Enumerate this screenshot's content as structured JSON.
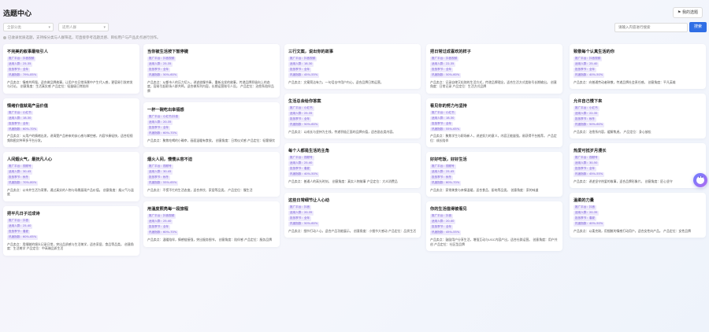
{
  "header": {
    "title": "选题中心",
    "my_button": "我的选题",
    "filters": [
      {
        "placeholder": "全部分类"
      },
      {
        "placeholder": "适用人群"
      }
    ],
    "search_placeholder": "请输入内容进行搜索",
    "search_button": "搜索",
    "tip": "已收录优质选题，支持按分类与人群筛选，可直接参考选题灵感、目标用户与产品卖点进行创作。"
  },
  "labels": {
    "category": "推广平台：",
    "audience": "适用人群：",
    "season": "投放季节：",
    "score": "热度指数：",
    "selling": "产品卖点：",
    "angle": "创意角度：",
    "scene": "产品定位："
  },
  "columns": [
    {
      "cards": [
        {
          "title": "不完美的叙事最吸引人",
          "tags": [
            "推广平台：抖音视频",
            "适用人群：25-35",
            "投放季节：全年",
            "热度指数：79%-85%"
          ],
          "desc": "产品卖点：情感共鸣强，适合做品牌故事，让用户在日常场景中产生代入感，更容易引发转发与讨论。 创意角度：生活真实感 产品定位：轻量级日常陪伴"
        },
        {
          "title": "情绪价值就是产品价值",
          "tags": [
            "推广平台：小红书",
            "适用人群：18-30",
            "投放季节：全年",
            "热度指数：60%-70%"
          ],
          "desc": "产品卖点：从用户的情绪出发，讲清楚产品带来的安心感与掌控感，内容节奏轻快，适合短视频和图文种草多平台分发。"
        },
        {
          "title": "人间烟火气，最抚凡人心",
          "tags": [
            "推广平台：视频号",
            "适用人群：30-45",
            "投放季节：秋冬",
            "热度指数：70%-80%"
          ],
          "desc": "产品卖点：以市井生活为背景，通过真实的人物与场景展现产品价值。 创意角度：烟火气与温度"
        },
        {
          "title": "把平凡日子过成诗",
          "tags": [
            "推广平台：抖音",
            "适用人群：25-40",
            "投放季节：春夏",
            "热度指数：60%-65%"
          ],
          "desc": "产品卖点：用细腻的镜头记录日常，突出品质感与生活美学，适合家居、食品等品类。 创意角度：生活美学 产品定位：中高端品质生活"
        }
      ]
    },
    {
      "cards": [
        {
          "title": "当你被生活按下暂停键",
          "tags": [
            "推广平台：抖音视频",
            "适用人群：25-35",
            "投放季节：全年",
            "热度指数：50%-60%"
          ],
          "desc": "产品卖点：从都市人的压力切入，讲述放慢节奏、重新出发的故事，传递品牌积极向上的态度，容易引起职场人群共鸣，适合做系列内容，长期运营账号人设。 产品定位：治愈系陪伴品牌"
        },
        {
          "title": "一杯一碗吃出幸福感",
          "tags": [
            "推广平台：小红书/抖音",
            "适用人群：20-35",
            "投放季节：全年",
            "热度指数：60%-70%"
          ],
          "desc": "产品卖点：聚焦吃喝的小确幸，画面温暖有食欲。 创意角度：日常仪式感 产品定位：轻奢餐饮"
        },
        {
          "title": "烟火人间，慢慢从容不迫",
          "tags": [
            "推广平台：视频号",
            "适用人群：30-45",
            "投放季节：秋冬",
            "热度指数：55%-65%"
          ],
          "desc": "产品卖点：不慌不忙的生活态度，适合茶饮、家居等品类。 产品定位：慢生活"
        },
        {
          "title": "用温度照亮每一段旅程",
          "tags": [
            "推广平台：抖音视频",
            "适用人群：25-40",
            "投放季节：全年",
            "热度指数：60%-70%"
          ],
          "desc": "产品卖点：温暖陪伴，情感链接强，突出服务细节。 创意角度：陪伴感 产品定位：服务品牌"
        }
      ]
    },
    {
      "cards": [
        {
          "title": "三行文案，说出你的故事",
          "tags": [
            "推广平台：抖音视频",
            "适用人群：18-30",
            "投放季节：全年",
            "热度指数：45%-55%"
          ],
          "desc": "产品卖点：文案简洁有力，一句话击中用户内心，适合品牌日常运营。"
        },
        {
          "title": "生活总会给你答案",
          "tags": [
            "推广平台：小红书",
            "适用人群：25-35",
            "投放季节：全年",
            "热度指数：50%-60%"
          ],
          "desc": "产品卖点：以成长与坚持为主线，传递积极正面的品牌价值，适合励志类内容。"
        },
        {
          "title": "每个人都是生活的主角",
          "tags": [
            "推广平台：视频号",
            "适用人群：25-40",
            "投放季节：春夏",
            "热度指数：40%-50%"
          ],
          "desc": "产品卖点：普通人的高光时刻。 创意角度：真实人物故事 产品定位：大众消费品"
        },
        {
          "title": "这些日常细节让人心动",
          "tags": [
            "推广平台：抖音",
            "适用人群：20-35",
            "投放季节：全年",
            "热度指数：50%-60%"
          ],
          "desc": "产品卖点：细节打动人心，适合产品功能展示。 创意角度：小细节大感动 产品定位：品质生活"
        }
      ]
    },
    {
      "cards": [
        {
          "title": "把日常过成喜欢的样子",
          "tags": [
            "推广平台：抖音视频",
            "适用人群：22-35",
            "投放季节：全年",
            "热度指数：50%-60%"
          ],
          "desc": "产品卖点：记录自律又松弛的生活方式，传递品牌理念，适合生活方式类账号长期输出。 创意角度：日常记录 产品定位：生活方式品牌"
        },
        {
          "title": "看见你的努力与坚持",
          "tags": [
            "推广平台：小红书",
            "适用人群：18-30",
            "投放季节：全年",
            "热度指数：55%-65%"
          ],
          "desc": "产品卖点：聚焦学生与职场新人，讲述努力的意义，内容正能量强，易获得平台推荐。 产品定位：成长陪伴"
        },
        {
          "title": "好好吃饭，好好生活",
          "tags": [
            "推广平台：视频号",
            "适用人群：25-45",
            "投放季节：秋冬",
            "热度指数：60%-70%"
          ],
          "desc": "产品卖点：家常美食与亲情温暖，适合食品、厨电等品类。 创意角度：家的味道"
        },
        {
          "title": "你的生活值得被看见",
          "tags": [
            "推广平台：抖音",
            "适用人群：20-40",
            "投放季节：全年",
            "热度指数：45%-55%"
          ],
          "desc": "产品卖点：鼓励用户分享生活，增强互动与UGC内容产出，适合社群运营。 创意角度：用户共创 产品定位：社区型品牌"
        }
      ]
    },
    {
      "cards": [
        {
          "title": "致敬每个认真生活的你",
          "tags": [
            "推广平台：抖音视频",
            "适用人群：25-40",
            "投放季节：全年",
            "热度指数：40%-50%"
          ],
          "desc": "产品卖点：向普通劳动者致敬，传递品牌社会责任感。 创意角度：平凡英雄"
        },
        {
          "title": "允许自己慢下来",
          "tags": [
            "推广平台：小红书",
            "适用人群：22-35",
            "投放季节：秋冬",
            "热度指数：50%-60%"
          ],
          "desc": "产品卖点：治愈系内容，缓解焦虑。 产品定位：身心放松"
        },
        {
          "title": "热爱可抵岁月漫长",
          "tags": [
            "推广平台：视频号",
            "适用人群：30-50",
            "投放季节：全年",
            "热度指数：45%-55%"
          ],
          "desc": "产品卖点：讲述坚守热爱的故事，适合品牌形象片。 创意角度：匠心坚守"
        },
        {
          "title": "温柔的力量",
          "tags": [
            "推广平台：抖音",
            "适用人群：20-35",
            "投放季节：春夏",
            "热度指数：40%-50%"
          ],
          "desc": "产品卖点：以柔克刚，用细腻的情感打动用户，适合女性向产品。 产品定位：女性品牌"
        }
      ]
    }
  ]
}
